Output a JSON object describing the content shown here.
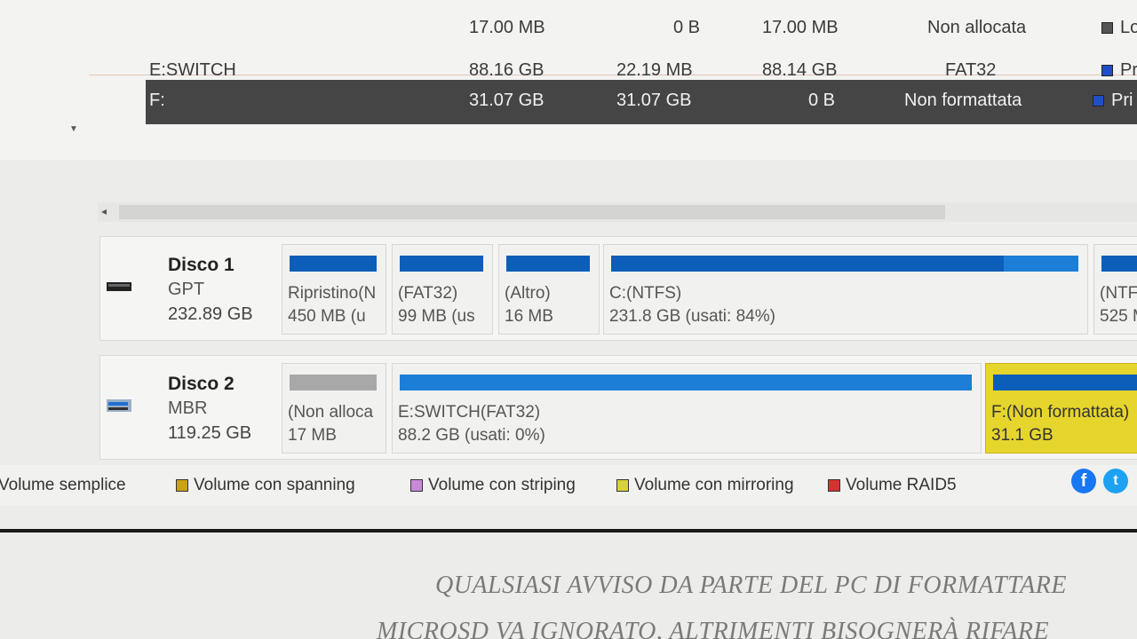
{
  "volume_table": {
    "rows": [
      {
        "name": "",
        "capacity": "17.00 MB",
        "used": "0 B",
        "free": "17.00 MB",
        "fs": "Non allocata",
        "type": "Lo",
        "type_color": "#555555",
        "selected": false
      },
      {
        "name": "E:SWITCH",
        "capacity": "88.16 GB",
        "used": "22.19 MB",
        "free": "88.14 GB",
        "fs": "FAT32",
        "type": "Pr",
        "type_color": "#1f4fc8",
        "selected": false
      },
      {
        "name": "F:",
        "capacity": "31.07 GB",
        "used": "31.07 GB",
        "free": "0 B",
        "fs": "Non formattata",
        "type": "Pri",
        "type_color": "#1f4fc8",
        "selected": true
      }
    ]
  },
  "disks": [
    {
      "name": "Disco 1",
      "type": "GPT",
      "size": "232.89 GB",
      "partitions": [
        {
          "label": "Ripristino(N",
          "size": "450 MB (u",
          "used_fraction": 1.0,
          "color": "#1c7ed6"
        },
        {
          "label": "(FAT32)",
          "size": "99 MB (us",
          "used_fraction": 1.0,
          "color": "#1c7ed6"
        },
        {
          "label": "(Altro)",
          "size": "16 MB",
          "used_fraction": 1.0,
          "color": "#1c7ed6"
        },
        {
          "label": "C:(NTFS)",
          "size": "231.8 GB (usati: 84%)",
          "used_fraction": 0.84,
          "color": "#1c7ed6"
        },
        {
          "label": "(NTF",
          "size": "525 M",
          "used_fraction": 1.0,
          "color": "#1c7ed6"
        }
      ]
    },
    {
      "name": "Disco 2",
      "type": "MBR",
      "size": "119.25 GB",
      "partitions": [
        {
          "label": "(Non alloca",
          "size": "17 MB",
          "used_fraction": 0,
          "color": "#a8a8a8"
        },
        {
          "label": "E:SWITCH(FAT32)",
          "size": "88.2 GB (usati: 0%)",
          "used_fraction": 0,
          "color": "#1c7ed6"
        },
        {
          "label": "F:(Non formattata)",
          "size": "31.1 GB",
          "used_fraction": 1.0,
          "color": "#1c7ed6",
          "selected": true
        }
      ]
    }
  ],
  "legend": {
    "items": [
      {
        "label": "Volume semplice",
        "color": ""
      },
      {
        "label": "Volume con spanning",
        "color": "#c9a21a"
      },
      {
        "label": "Volume con striping",
        "color": "#c78ad8"
      },
      {
        "label": "Volume con mirroring",
        "color": "#d8d23a"
      },
      {
        "label": "Volume RAID5",
        "color": "#d8322f"
      }
    ]
  },
  "social": {
    "facebook": "f",
    "twitter": "t"
  },
  "note": {
    "line1": "QUALSIASI AVVISO DA PARTE DEL PC DI FORMATTARE",
    "line2": "MICROSD VA IGNORATO, ALTRIMENTI BISOGNERÀ RIFARE"
  }
}
